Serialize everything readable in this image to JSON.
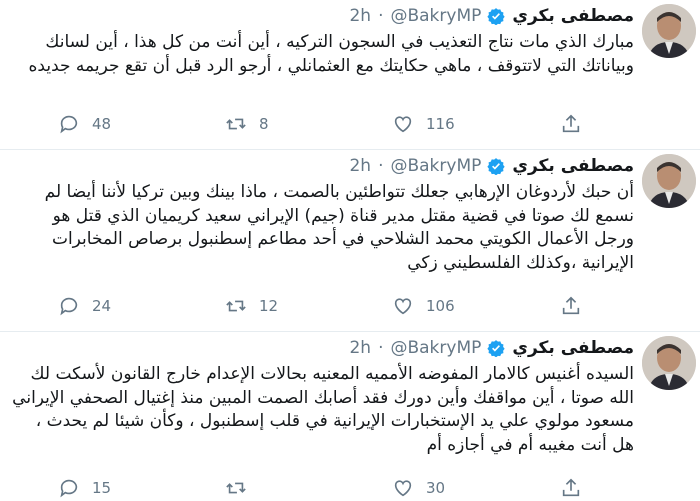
{
  "tweets": [
    {
      "name": "مصطفى بكري",
      "handle": "@BakryMP",
      "time": "2h",
      "text": "مبارك الذي مات نتاج التعذيب في السجون التركيه ، أين أنت من كل هذا ، أين لسانك وبياناتك التي لاتتوقف ، ماهي حكايتك مع العثمانلي ، أرجو الرد قبل أن تقع جريمه جديده",
      "replies": "48",
      "retweets": "8",
      "likes": "116"
    },
    {
      "name": "مصطفى بكري",
      "handle": "@BakryMP",
      "time": "2h",
      "text": "أن حبك لأردوغان الإرهابي جعلك تتواطئين بالصمت ، ماذا بينك وبين تركيا لأننا أيضا لم نسمع لك صوتا في قضية مقتل مدير قناة (جيم) الإيراني سعيد كريميان الذي قتل هو ورجل الأعمال الكويتي محمد الشلاحي في أحد مطاعم إسطنبول برصاص المخابرات الإيرانية ،وكذلك الفلسطيني زكي",
      "replies": "24",
      "retweets": "12",
      "likes": "106"
    },
    {
      "name": "مصطفى بكري",
      "handle": "@BakryMP",
      "time": "2h",
      "text": "السيده أغنيس كالامار المفوضه الأمميه المعنيه بحالات الإعدام خارج القانون لأسكت لك الله صوتا ، أين مواقفك وأين دورك فقد أصابك الصمت المبين منذ إغتيال الصحفي الإيراني مسعود مولوي علي يد الإستخبارات الإيرانية في قلب إسطنبول ، وكأن شيئا لم يحدث ، هل أنت مغيبه أم في أجازه أم",
      "replies": "15",
      "retweets": "",
      "likes": "30"
    }
  ],
  "colors": {
    "muted": "#657786",
    "verified": "#1da1f2",
    "divider": "#e6ecf0"
  }
}
